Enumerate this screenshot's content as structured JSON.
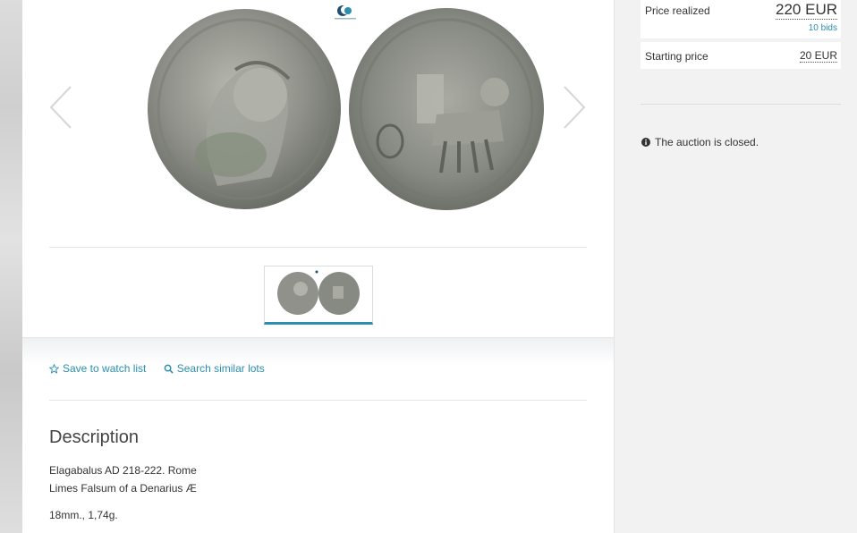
{
  "gallery": {
    "logo_text": "SIXBID COINS",
    "prev_label": "Previous image",
    "next_label": "Next image"
  },
  "actions": {
    "watch_label": "Save to watch list",
    "similar_label": "Search similar lots"
  },
  "description": {
    "title": "Description",
    "line1": "Elagabalus AD 218-222. Rome",
    "line2": "Limes Falsum of a Denarius Æ",
    "line3": "18mm., 1,74g."
  },
  "pricing": {
    "realized_label": "Price realized",
    "realized_value": "220 EUR",
    "bids": "10 bids",
    "starting_label": "Starting price",
    "starting_value": "20 EUR"
  },
  "status": {
    "closed_text": "The auction is closed."
  },
  "colors": {
    "accent": "#2a8fb1",
    "coin_silver": "#9a9c95"
  }
}
